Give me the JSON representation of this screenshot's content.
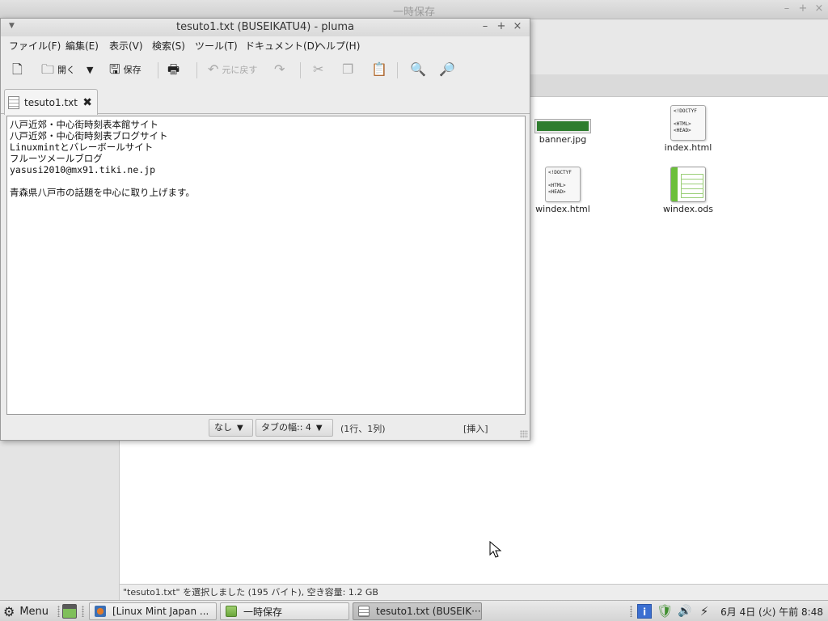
{
  "file_manager": {
    "title": "一時保存",
    "controls": {
      "minimize": "–",
      "maximize": "+",
      "close": "×"
    },
    "files": [
      {
        "name": "banner.jpg",
        "kind": "image"
      },
      {
        "name": "index.html",
        "kind": "html",
        "icon_text": [
          "<!DOCTYF",
          "",
          "<HTML>",
          "<HEAD>"
        ]
      },
      {
        "name": "windex.html",
        "kind": "html",
        "icon_text": [
          "<!DOCTYF",
          "",
          "<HTML>",
          "<HEAD>"
        ]
      },
      {
        "name": "windex.ods",
        "kind": "spreadsheet"
      }
    ],
    "status": "\"tesuto1.txt\" を選択しました (195 バイト), 空き容量: 1.2 GB"
  },
  "pluma": {
    "title": "tesuto1.txt (BUSEIKATU4) - pluma",
    "controls": {
      "minimize": "–",
      "maximize": "+",
      "close": "×"
    },
    "menu": [
      "ファイル(F)",
      "編集(E)",
      "表示(V)",
      "検索(S)",
      "ツール(T)",
      "ドキュメント(D)",
      "ヘルプ(H)"
    ],
    "toolbar": {
      "open_label": "開く",
      "save_label": "保存",
      "undo_label": "元に戻す"
    },
    "tab": {
      "label": "tesuto1.txt",
      "close": "✖"
    },
    "editor_lines": [
      "八戸近郊・中心街時刻表本館サイト",
      "八戸近郊・中心街時刻表ブログサイト",
      "Linuxmintとバレーボールサイト",
      "フルーツメールブログ",
      "yasusi2010@mx91.tiki.ne.jp",
      "",
      "青森県八戸市の話題を中心に取り上げます。"
    ],
    "statusbar": {
      "highlight_mode": "なし",
      "tab_width": "タブの幅:: 4",
      "position": "(1行、1列)",
      "mode": "[挿入]"
    }
  },
  "taskbar": {
    "menu_label": "Menu",
    "tasks": [
      {
        "label": "[Linux Mint Japan ...",
        "active": false
      },
      {
        "label": "一時保存",
        "active": false
      },
      {
        "label": "tesuto1.txt (BUSEIK···",
        "active": true
      }
    ],
    "clock": "6月 4日 (火) 午前 8:48"
  }
}
